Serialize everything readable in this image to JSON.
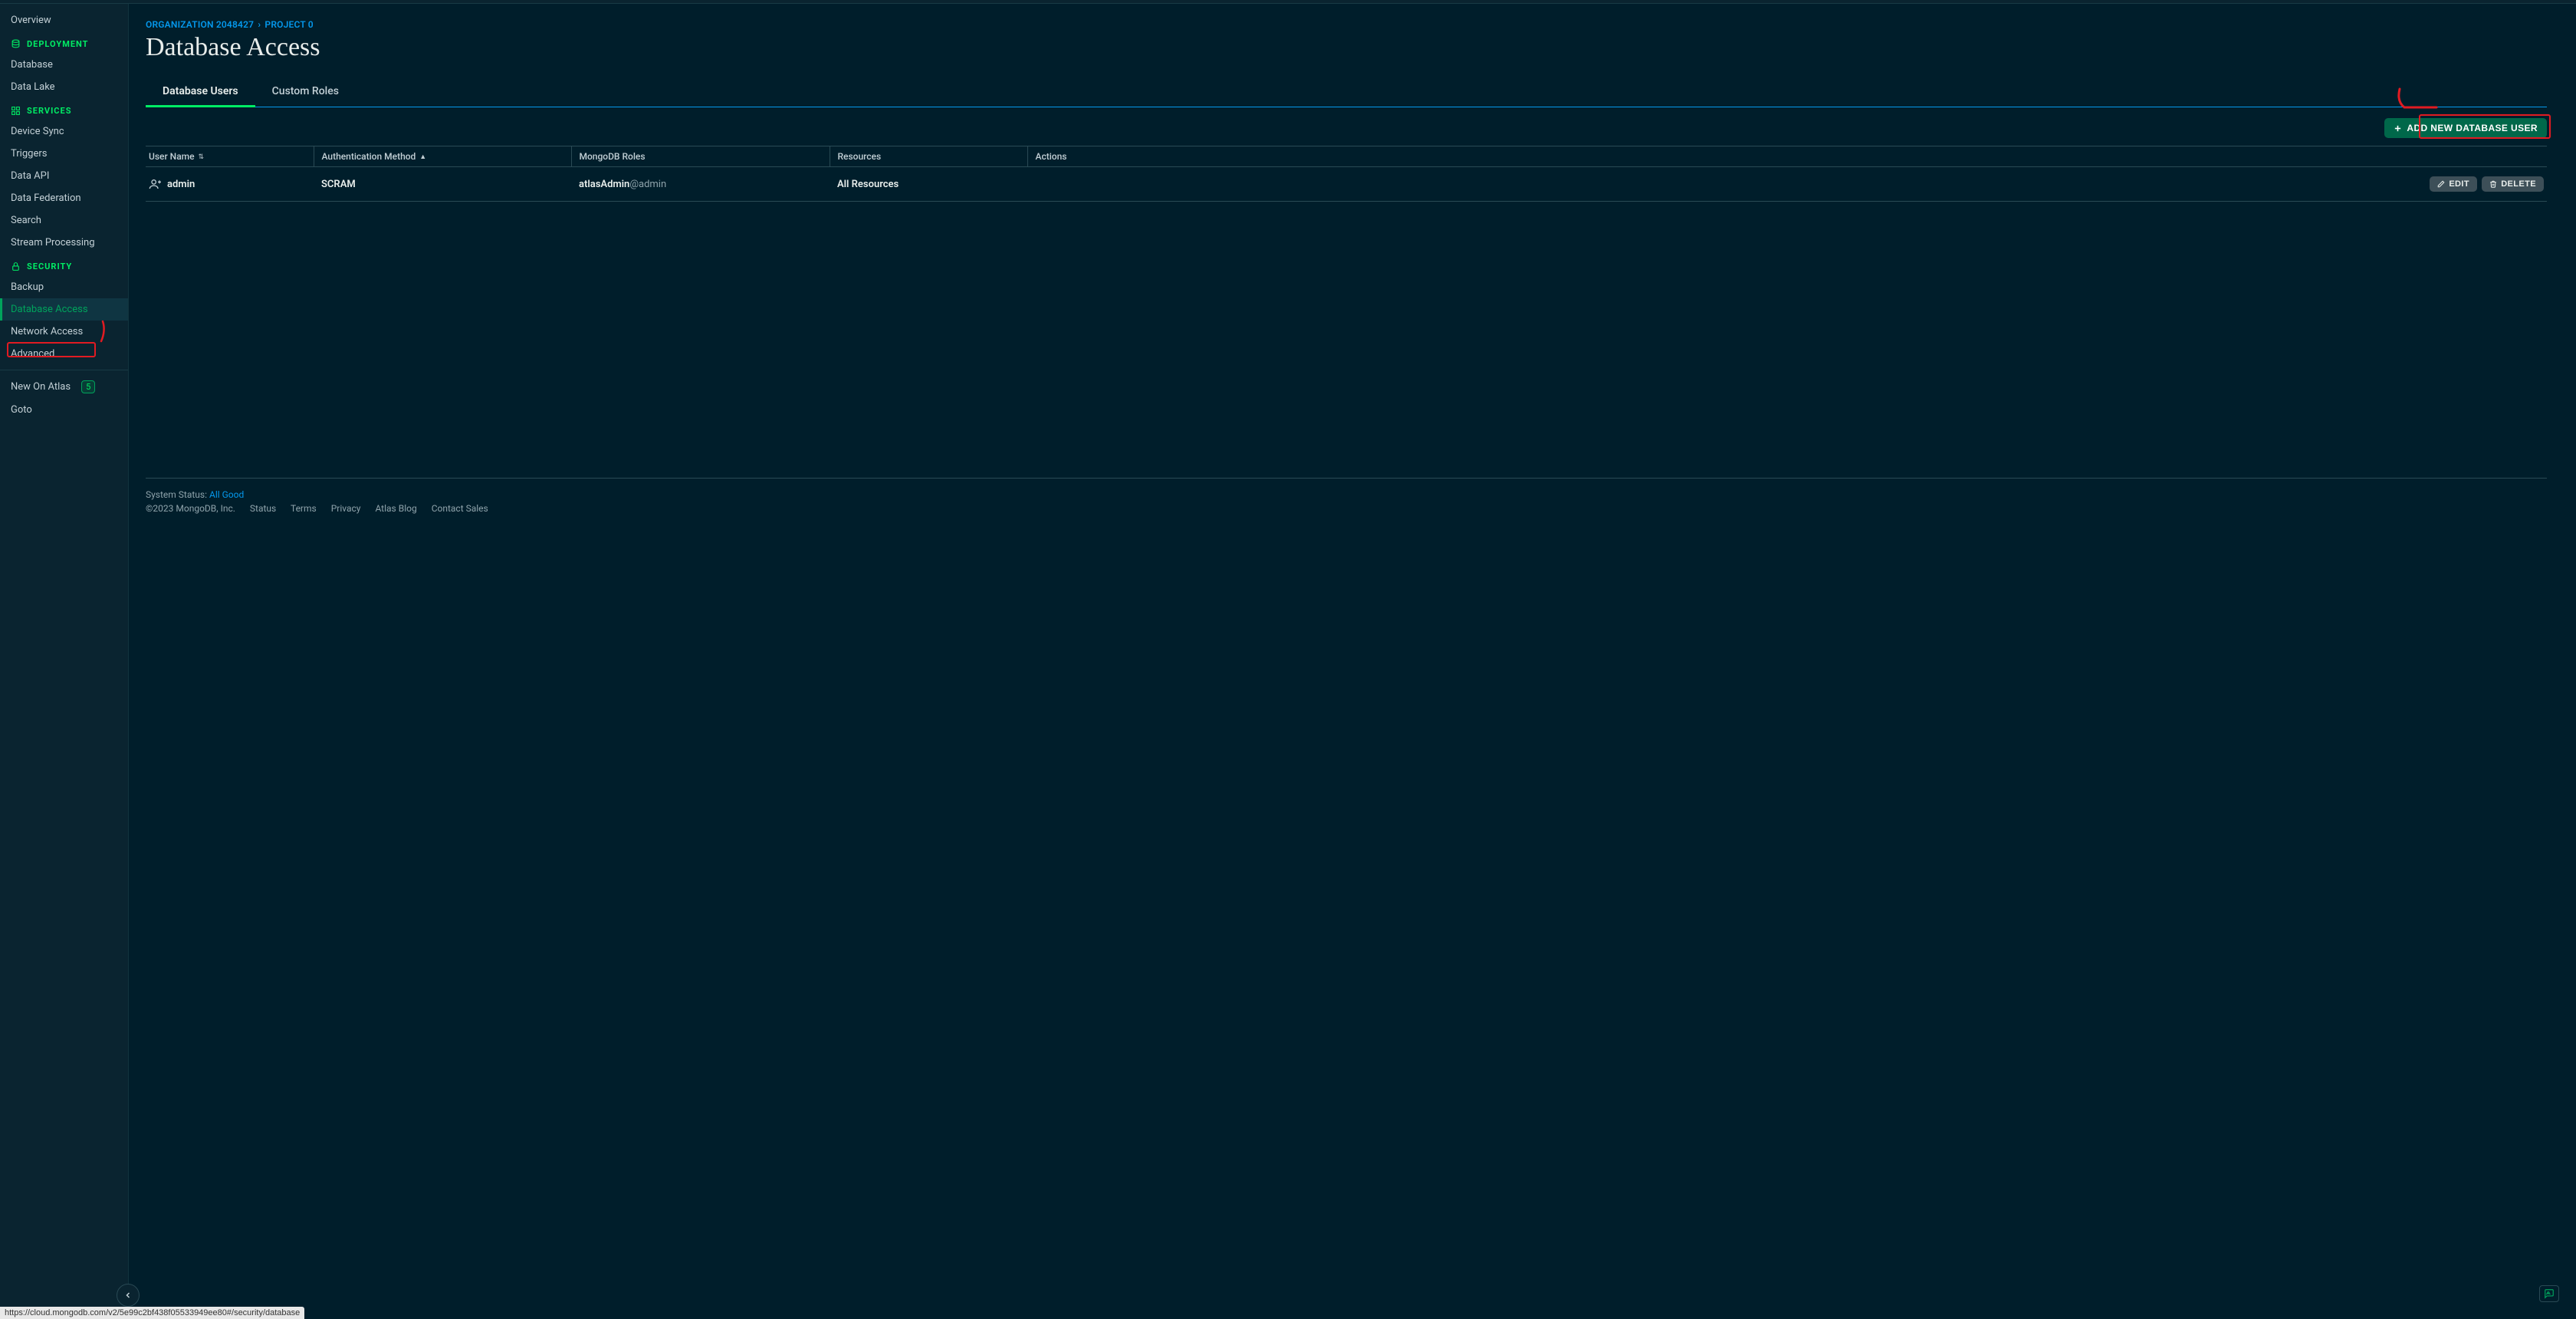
{
  "breadcrumb": {
    "org": "ORGANIZATION 2048427",
    "proj": "PROJECT 0"
  },
  "page_title": "Database Access",
  "sidebar": {
    "overview": "Overview",
    "deployment_header": "DEPLOYMENT",
    "database": "Database",
    "data_lake": "Data Lake",
    "services_header": "SERVICES",
    "device_sync": "Device Sync",
    "triggers": "Triggers",
    "data_api": "Data API",
    "data_federation": "Data Federation",
    "search": "Search",
    "stream_processing": "Stream Processing",
    "security_header": "SECURITY",
    "backup": "Backup",
    "database_access": "Database Access",
    "network_access": "Network Access",
    "advanced": "Advanced",
    "new_on_atlas": "New On Atlas",
    "new_on_atlas_count": "5",
    "goto": "Goto"
  },
  "tabs": {
    "users": "Database Users",
    "roles": "Custom Roles"
  },
  "toolbar": {
    "add_user": "ADD NEW DATABASE USER"
  },
  "table": {
    "headers": {
      "user": "User Name",
      "auth": "Authentication Method",
      "roles": "MongoDB Roles",
      "resources": "Resources",
      "actions": "Actions"
    },
    "rows": [
      {
        "user": "admin",
        "auth": "SCRAM",
        "role_main": "atlasAdmin",
        "role_suffix": "@admin",
        "resources": "All Resources"
      }
    ],
    "edit_label": "EDIT",
    "delete_label": "DELETE"
  },
  "footer": {
    "status_label": "System Status: ",
    "status_value": "All Good",
    "copyright": "©2023 MongoDB, Inc.",
    "links": {
      "status": "Status",
      "terms": "Terms",
      "privacy": "Privacy",
      "blog": "Atlas Blog",
      "contact": "Contact Sales"
    }
  },
  "status_url": "https://cloud.mongodb.com/v2/5e99c2bf438f05533949ee80#/security/database"
}
